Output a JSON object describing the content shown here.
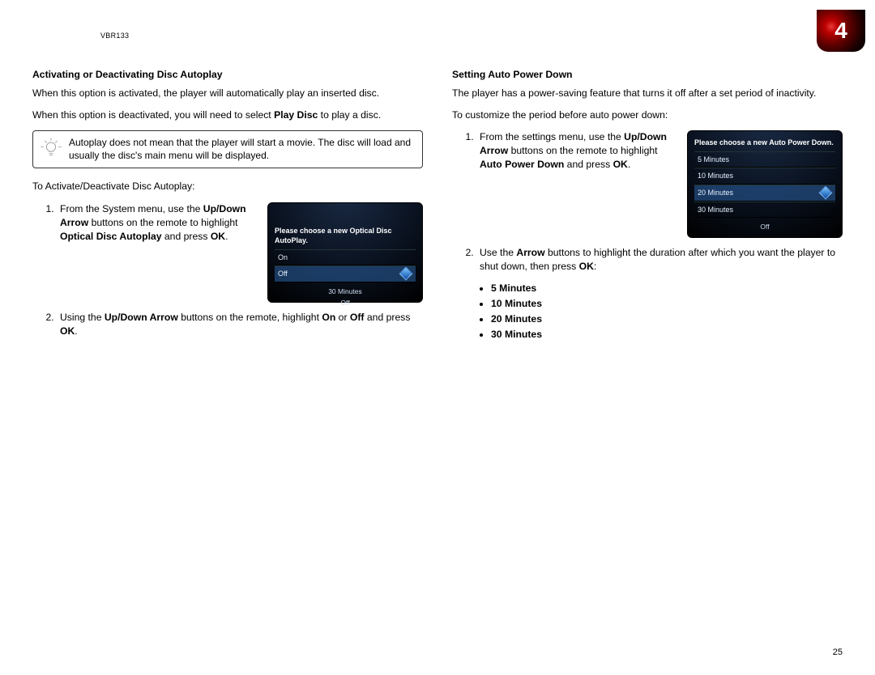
{
  "header": {
    "model": "VBR133",
    "chapter": "4",
    "page": "25"
  },
  "left": {
    "heading": "Activating or Deactivating Disc Autoplay",
    "p1": "When this option is activated, the player will automatically play an inserted disc.",
    "p2a": "When this option is deactivated, you will need to select ",
    "p2b": "Play Disc",
    "p2c": " to play a disc.",
    "tip": "Autoplay does not mean that the player will start a movie. The disc will load and usually the disc's main menu will be displayed.",
    "pre_steps": "To Activate/Deactivate Disc Autoplay:",
    "step1_a": "From the System menu, use the ",
    "step1_b": "Up/Down Arrow",
    "step1_c": " buttons on the remote to highlight ",
    "step1_d": "Optical Disc Autoplay",
    "step1_e": " and press ",
    "step1_f": "OK",
    "step1_g": ".",
    "step2_a": "Using the ",
    "step2_b": "Up/Down Arrow",
    "step2_c": " buttons on the remote, highlight ",
    "step2_d": "On",
    "step2_e": " or ",
    "step2_f": "Off",
    "step2_g": " and press ",
    "step2_h": "OK",
    "step2_i": ".",
    "screen": {
      "title": "Please choose a new Optical Disc AutoPlay.",
      "opts": [
        "On",
        "Off"
      ],
      "sel_index": 1,
      "below1": "30 Minutes",
      "below2": "Off"
    }
  },
  "right": {
    "heading": "Setting Auto Power Down",
    "p1": "The player has a power-saving feature that turns it off after a set period of inactivity.",
    "p2": "To customize the period before auto power down:",
    "step1_a": "From the settings menu, use the ",
    "step1_b": "Up/Down Arrow",
    "step1_c": " buttons on the remote to highlight ",
    "step1_d": "Auto Power Down",
    "step1_e": " and press ",
    "step1_f": "OK",
    "step1_g": ".",
    "step2_a": "Use the ",
    "step2_b": "Arrow",
    "step2_c": " buttons to highlight the duration after which you want the player to shut down, then press ",
    "step2_d": "OK",
    "step2_e": ":",
    "minutes": [
      "5 Minutes",
      "10 Minutes",
      "20 Minutes",
      "30 Minutes"
    ],
    "screen": {
      "title": "Please choose a new Auto Power Down.",
      "opts": [
        "5 Minutes",
        "10 Minutes",
        "20 Minutes",
        "30 Minutes"
      ],
      "sel_index": 2,
      "below1": "Off"
    }
  }
}
